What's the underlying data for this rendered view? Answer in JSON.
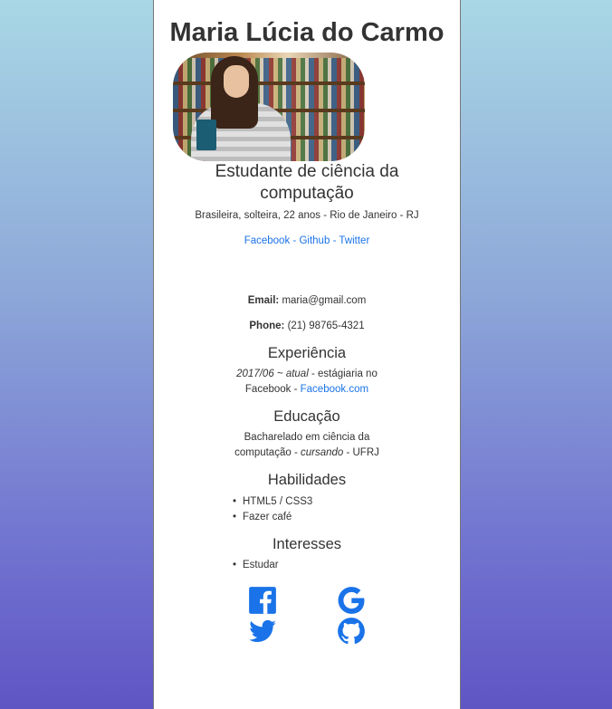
{
  "profile": {
    "name": "Maria Lúcia do Carmo",
    "title": "Estudante de ciência da computação",
    "subtitle": "Brasileira, solteira, 22 anos - Rio de Janeiro - RJ",
    "links": {
      "facebook": "Facebook",
      "github": "Github",
      "twitter": "Twitter",
      "sep": "-"
    }
  },
  "contact": {
    "email_label": "Email:",
    "email": "maria@gmail.com",
    "phone_label": "Phone:",
    "phone": "(21) 98765-4321"
  },
  "experience": {
    "heading": "Experiência",
    "date": "2017/06 ~ atual",
    "text": " - estágiaria no Facebook - ",
    "link": "Facebook.com"
  },
  "education": {
    "heading": "Educação",
    "text1": "Bacharelado em ciência da computação - ",
    "status": "cursando",
    "text2": " - UFRJ"
  },
  "skills": {
    "heading": "Habilidades",
    "items": [
      "HTML5 / CSS3",
      "Fazer café"
    ]
  },
  "interests": {
    "heading": "Interesses",
    "items": [
      "Estudar"
    ]
  },
  "icons": [
    "facebook-icon",
    "google-icon",
    "twitter-icon",
    "github-icon"
  ],
  "colors": {
    "link": "#1a73e8",
    "text": "#333333"
  }
}
